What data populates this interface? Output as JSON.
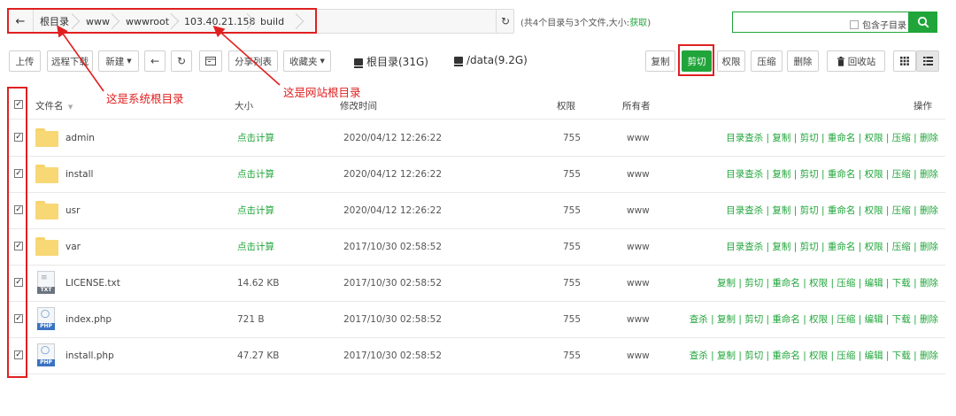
{
  "path": {
    "crumbs": [
      "根目录",
      "www",
      "wwwroot",
      "103.40.21.158",
      "build"
    ],
    "summary": "(共4个目录与3个文件,大小:",
    "summary_link": "获取",
    "summary_end": ")"
  },
  "search": {
    "placeholder": "",
    "include_subdir_label": "包含子目录"
  },
  "toolbar": {
    "upload": "上传",
    "remote_download": "远程下载",
    "new": "新建",
    "share_list": "分享列表",
    "favorites": "收藏夹",
    "disk_root": "根目录(31G)",
    "disk_data": "/data(9.2G)",
    "copy": "复制",
    "cut": "剪切",
    "permission": "权限",
    "compress": "压缩",
    "delete": "删除",
    "recycle": "回收站"
  },
  "annotations": {
    "system_root": "这是系统根目录",
    "site_root": "这是网站根目录"
  },
  "table": {
    "headers": {
      "name": "文件名",
      "size": "大小",
      "mtime": "修改时间",
      "perm": "权限",
      "owner": "所有者",
      "ops": "操作"
    },
    "rows": [
      {
        "type": "folder",
        "name": "admin",
        "size": "点击计算",
        "mtime": "2020/04/12 12:26:22",
        "perm": "755",
        "owner": "www",
        "ops": "目录查杀 | 复制 | 剪切 | 重命名 | 权限 | 压缩 | 删除"
      },
      {
        "type": "folder",
        "name": "install",
        "size": "点击计算",
        "mtime": "2020/04/12 12:26:22",
        "perm": "755",
        "owner": "www",
        "ops": "目录查杀 | 复制 | 剪切 | 重命名 | 权限 | 压缩 | 删除"
      },
      {
        "type": "folder",
        "name": "usr",
        "size": "点击计算",
        "mtime": "2020/04/12 12:26:22",
        "perm": "755",
        "owner": "www",
        "ops": "目录查杀 | 复制 | 剪切 | 重命名 | 权限 | 压缩 | 删除"
      },
      {
        "type": "folder",
        "name": "var",
        "size": "点击计算",
        "mtime": "2017/10/30 02:58:52",
        "perm": "755",
        "owner": "www",
        "ops": "目录查杀 | 复制 | 剪切 | 重命名 | 权限 | 压缩 | 删除"
      },
      {
        "type": "txt",
        "name": "LICENSE.txt",
        "size": "14.62 KB",
        "mtime": "2017/10/30 02:58:52",
        "perm": "755",
        "owner": "www",
        "ops": "复制 | 剪切 | 重命名 | 权限 | 压缩 | 编辑 | 下载 | 删除"
      },
      {
        "type": "php",
        "name": "index.php",
        "size": "721 B",
        "mtime": "2017/10/30 02:58:52",
        "perm": "755",
        "owner": "www",
        "ops": "查杀 | 复制 | 剪切 | 重命名 | 权限 | 压缩 | 编辑 | 下载 | 删除"
      },
      {
        "type": "php",
        "name": "install.php",
        "size": "47.27 KB",
        "mtime": "2017/10/30 02:58:52",
        "perm": "755",
        "owner": "www",
        "ops": "查杀 | 复制 | 剪切 | 重命名 | 权限 | 压缩 | 编辑 | 下载 | 删除"
      }
    ],
    "file_labels": {
      "txt": "TXT",
      "php": "PHP"
    }
  },
  "colors": {
    "accent": "#20a53a",
    "annotation": "#e02020"
  }
}
